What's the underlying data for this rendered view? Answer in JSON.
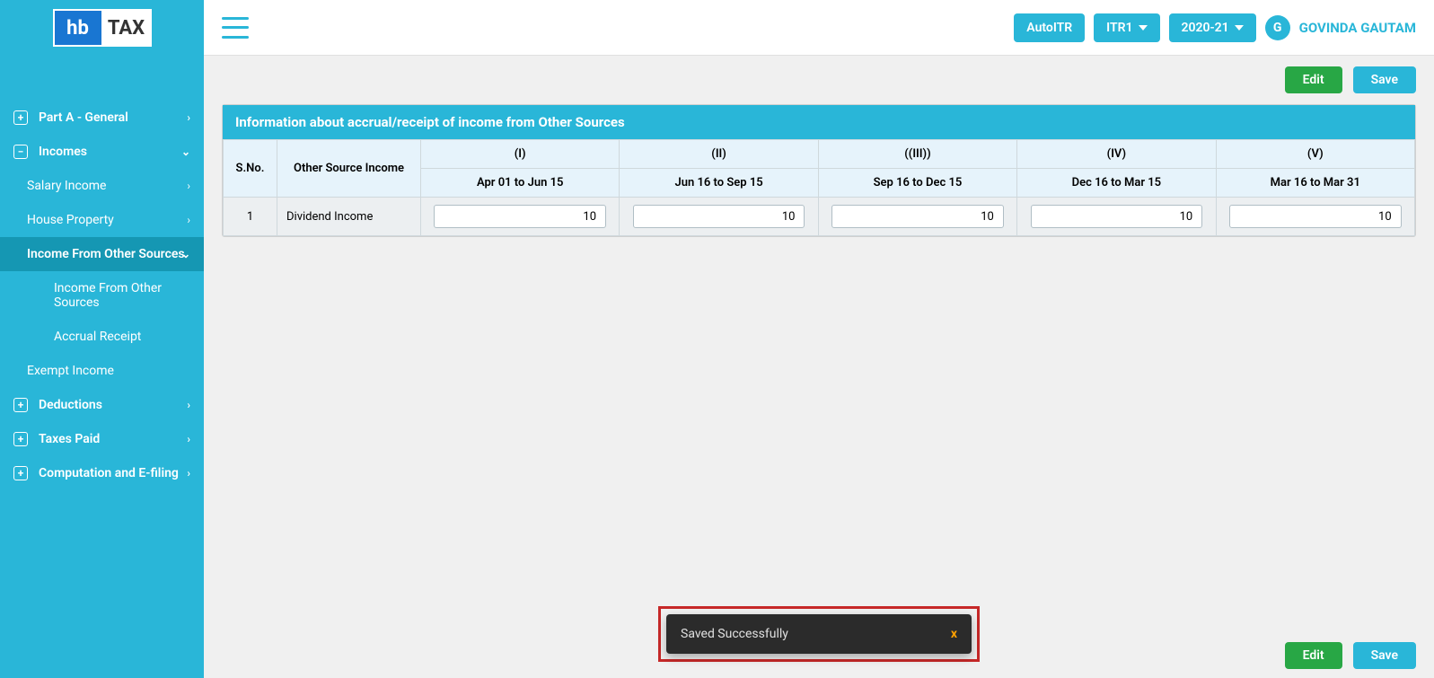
{
  "logo": {
    "hb": "hb",
    "tax": "TAX"
  },
  "header": {
    "autoItr": "AutoITR",
    "itrType": "ITR1",
    "year": "2020-21",
    "userInitial": "G",
    "userName": "GOVINDA GAUTAM"
  },
  "sidebar": {
    "partA": "Part A - General",
    "incomes": "Incomes",
    "salary": "Salary Income",
    "house": "House Property",
    "other": "Income From Other Sources",
    "otherSub1": "Income From Other Sources",
    "otherSub2": "Accrual Receipt",
    "exempt": "Exempt Income",
    "deductions": "Deductions",
    "taxes": "Taxes Paid",
    "computation": "Computation and E-filing"
  },
  "actions": {
    "edit": "Edit",
    "save": "Save"
  },
  "panel": {
    "title": "Information about accrual/receipt of income from Other Sources",
    "cols": {
      "sno": "S.No.",
      "osi": "Other Source Income",
      "c1r": "(I)",
      "c1p": "Apr 01 to Jun 15",
      "c2r": "(II)",
      "c2p": "Jun 16 to Sep 15",
      "c3r": "((III))",
      "c3p": "Sep 16 to Dec 15",
      "c4r": "(IV)",
      "c4p": "Dec 16 to Mar 15",
      "c5r": "(V)",
      "c5p": "Mar 16 to Mar 31"
    },
    "row": {
      "sno": "1",
      "label": "Dividend Income",
      "v1": "10",
      "v2": "10",
      "v3": "10",
      "v4": "10",
      "v5": "10"
    }
  },
  "toast": {
    "msg": "Saved Successfully",
    "close": "x"
  }
}
